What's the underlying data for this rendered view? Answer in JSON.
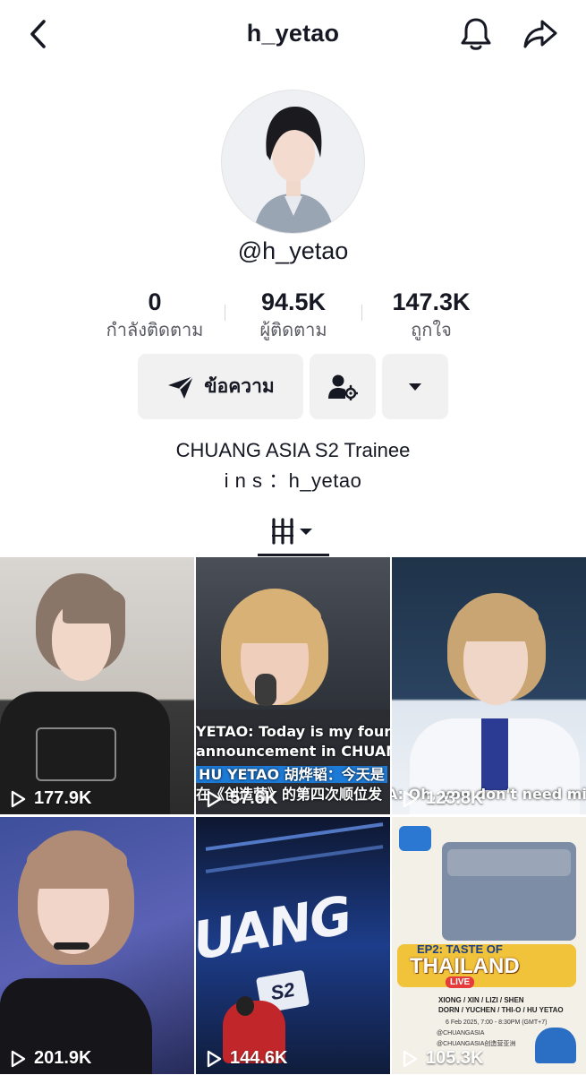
{
  "header": {
    "title": "h_yetao",
    "back_icon": "chevron-left-icon",
    "bell_icon": "bell-icon",
    "share_icon": "share-arrow-icon"
  },
  "profile": {
    "handle": "@h_yetao",
    "avatar_icon": "profile-avatar"
  },
  "stats": [
    {
      "value": "0",
      "label": "กำลังติดตาม"
    },
    {
      "value": "94.5K",
      "label": "ผู้ติดตาม"
    },
    {
      "value": "147.3K",
      "label": "ถูกใจ"
    }
  ],
  "actions": {
    "message_label": "ข้อความ",
    "message_icon": "send-icon",
    "add_friend_icon": "user-settings-icon",
    "more_icon": "caret-down-icon"
  },
  "bio": {
    "line1": "CHUANG ASIA S2 Trainee",
    "line2": "i n s ：h_yetao"
  },
  "tabs": {
    "grid_icon": "video-grid-icon"
  },
  "videos": [
    {
      "views": "177.9K"
    },
    {
      "views": "57.6K",
      "caption1": "YETAO: Today is my fourth",
      "caption2": "announcement in CHUANG",
      "caption3": "HU YETAO 胡烨韬：今天是",
      "caption4": "在《创造营》的第四次顺位发"
    },
    {
      "views": "123.8K",
      "caption1": "A: Oh, you don't need mic?"
    },
    {
      "views": "201.9K"
    },
    {
      "views": "144.6K",
      "overlay_text": "UANG",
      "overlay_text2": "S2"
    },
    {
      "views": "105.3K",
      "poster_title1": "EP2: TASTE OF",
      "poster_title2": "THAILAND",
      "poster_live": "LIVE",
      "poster_names1": "XIONG / XIN / LIZI / SHEN",
      "poster_names2": "DORN / YUCHEN / THI-O / HU YETAO",
      "poster_date": "6 Feb 2025, 7:00 - 8:30PM (GMT+7)",
      "poster_handle1": "@CHUANGASIA",
      "poster_handle2": "@CHUANGASIA创造营亚洲"
    }
  ],
  "colors": {
    "text_primary": "#161823",
    "button_bg": "#f1f1f2",
    "caption_highlight": "#1d7bd8"
  }
}
